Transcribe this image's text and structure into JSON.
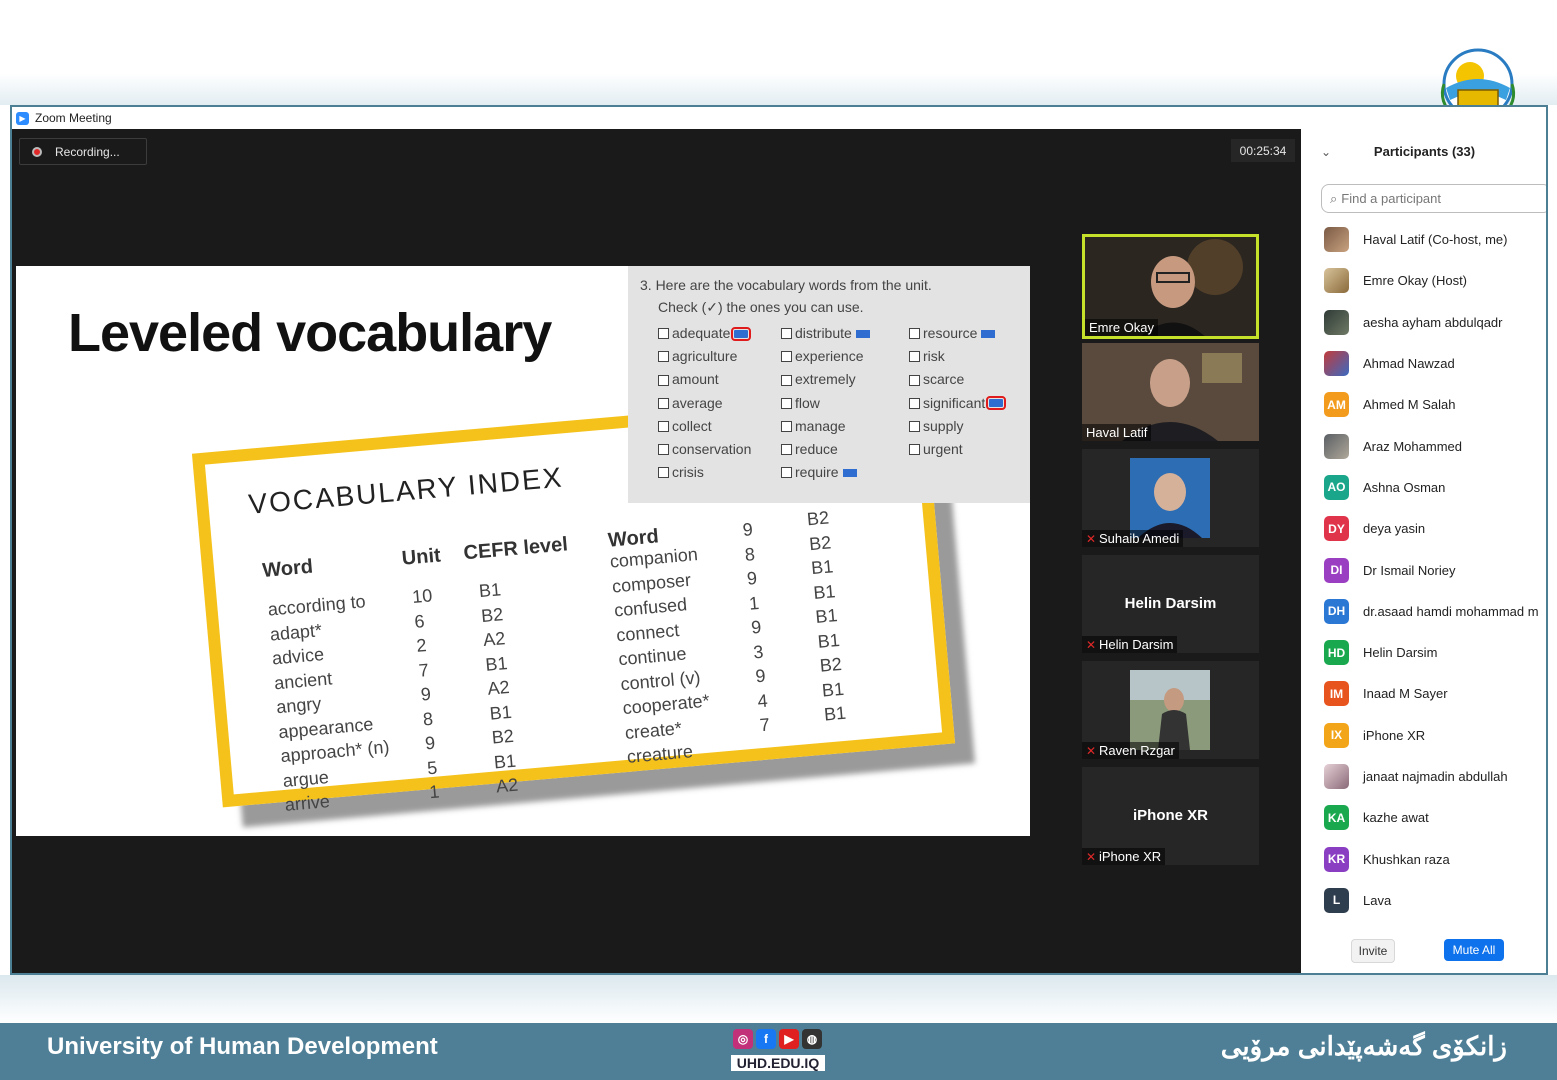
{
  "window": {
    "title": "Zoom Meeting"
  },
  "recording": {
    "label": "Recording..."
  },
  "timer": "00:25:34",
  "slide": {
    "title": "Leveled vocabulary",
    "vocab_index": {
      "title": "VOCABULARY INDEX",
      "headers": [
        "Word",
        "Unit",
        "CEFR level",
        "Word"
      ],
      "words_1": [
        "according to",
        "adapt*",
        "advice",
        "ancient",
        "angry",
        "appearance",
        "approach* (n)",
        "argue",
        "arrive"
      ],
      "units_1": [
        "10",
        "6",
        "2",
        "7",
        "9",
        "8",
        "9",
        "5",
        "1"
      ],
      "levels_1": [
        "B1",
        "B2",
        "A2",
        "B1",
        "A2",
        "B1",
        "B2",
        "B1",
        "A2"
      ],
      "words_2": [
        "companion",
        "composer",
        "confused",
        "connect",
        "continue",
        "control (v)",
        "cooperate*",
        "create*",
        "creature"
      ],
      "units_2": [
        "9",
        "8",
        "9",
        "1",
        "9",
        "3",
        "9",
        "4",
        "7"
      ],
      "levels_2": [
        "B2",
        "B2",
        "B1",
        "B1",
        "B1",
        "B1",
        "B2",
        "B1",
        "B1"
      ]
    },
    "exercise": {
      "line1": "3.  Here are the vocabulary words from the unit.",
      "line2": "Check (✓) the ones you can use.",
      "col1": [
        "adequate",
        "agriculture",
        "amount",
        "average",
        "collect",
        "conservation",
        "crisis"
      ],
      "col2": [
        "distribute",
        "experience",
        "extremely",
        "flow",
        "manage",
        "reduce",
        "require"
      ],
      "col3": [
        "resource",
        "risk",
        "scarce",
        "significant",
        "supply",
        "urgent"
      ]
    }
  },
  "video_tiles": [
    {
      "name": "Emre Okay"
    },
    {
      "name": "Haval Latif"
    },
    {
      "name": "Suhaib Amedi"
    },
    {
      "name": "Helin Darsim",
      "display": "Helin Darsim"
    },
    {
      "name": "Raven Rzgar"
    },
    {
      "name": "iPhone XR",
      "display": "iPhone XR"
    }
  ],
  "participants": {
    "header": "Participants (33)",
    "search_placeholder": "Find a participant",
    "list": [
      {
        "initials": "",
        "name": "Haval Latif (Co-host, me)",
        "color": "#6b4a3a"
      },
      {
        "initials": "",
        "name": "Emre Okay (Host)",
        "color": "#c9a26b"
      },
      {
        "initials": "",
        "name": "aesha ayham abdulqadr",
        "color": "#3a3f44"
      },
      {
        "initials": "",
        "name": "Ahmad Nawzad",
        "color": "#4a6aa8"
      },
      {
        "initials": "AM",
        "name": "Ahmed M Salah",
        "color": "#f29b1d"
      },
      {
        "initials": "",
        "name": "Araz Mohammed",
        "color": "#555b60"
      },
      {
        "initials": "AO",
        "name": "Ashna Osman",
        "color": "#1aa68a"
      },
      {
        "initials": "DY",
        "name": "deya yasin",
        "color": "#e0344b"
      },
      {
        "initials": "DI",
        "name": "Dr Ismail Noriey",
        "color": "#9b3fc2"
      },
      {
        "initials": "DH",
        "name": "dr.asaad hamdi mohammad m",
        "color": "#2a77d4"
      },
      {
        "initials": "HD",
        "name": "Helin Darsim",
        "color": "#1aa84f"
      },
      {
        "initials": "IM",
        "name": "Inaad M Sayer",
        "color": "#e8541e"
      },
      {
        "initials": "IX",
        "name": "iPhone XR",
        "color": "#f3a51a"
      },
      {
        "initials": "",
        "name": "janaat najmadin abdullah",
        "color": "#c7a0a8"
      },
      {
        "initials": "KA",
        "name": "kazhe awat",
        "color": "#1aa84f"
      },
      {
        "initials": "KR",
        "name": "Khushkan raza",
        "color": "#8a3fc2"
      },
      {
        "initials": "L",
        "name": "Lava",
        "color": "#2f3e4e"
      }
    ],
    "invite_label": "Invite",
    "mute_all_label": "Mute All"
  },
  "footer": {
    "left": "University of Human Development",
    "right": "زانكۆی گەشەپێدانی مرۆیی",
    "url": "UHD.EDU.IQ"
  }
}
